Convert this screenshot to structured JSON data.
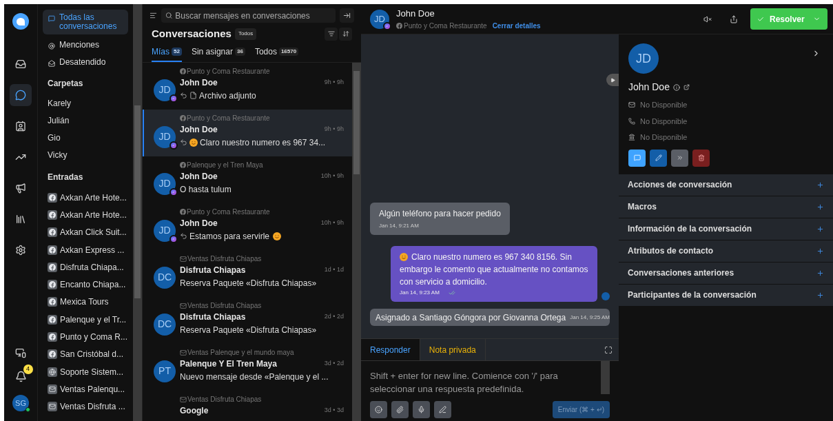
{
  "rail": {
    "items": [
      {
        "kind": "inbox",
        "selected": false
      },
      {
        "kind": "chat",
        "selected": true
      },
      {
        "kind": "contacts",
        "selected": false
      },
      {
        "kind": "reports",
        "selected": false
      },
      {
        "kind": "campaigns",
        "selected": false
      },
      {
        "kind": "library",
        "selected": false
      },
      {
        "kind": "settings",
        "selected": false
      }
    ],
    "bottom": {
      "notifications": "4",
      "avatar": "SG"
    }
  },
  "sidebar": {
    "nav": [
      {
        "label": "Todas las conversaciones",
        "selected": true
      },
      {
        "label": "Menciones",
        "selected": false
      },
      {
        "label": "Desatendido",
        "selected": false
      }
    ],
    "folders_title": "Carpetas",
    "folders": [
      "Karely",
      "Julián",
      "Gio",
      "Vicky"
    ],
    "inboxes_title": "Entradas",
    "inboxes": [
      {
        "name": "Axkan Arte Hote...",
        "kind": "facebook"
      },
      {
        "name": "Axkan Arte Hote...",
        "kind": "facebook"
      },
      {
        "name": "Axkan Click Suit...",
        "kind": "facebook"
      },
      {
        "name": "Axkan Express ...",
        "kind": "facebook"
      },
      {
        "name": "Disfruta Chiapa...",
        "kind": "facebook"
      },
      {
        "name": "Encanto Chiapa...",
        "kind": "facebook"
      },
      {
        "name": "Mexica Tours",
        "kind": "facebook"
      },
      {
        "name": "Palenque y el Tr...",
        "kind": "facebook"
      },
      {
        "name": "Punto y Coma R...",
        "kind": "facebook"
      },
      {
        "name": "San Cristóbal d...",
        "kind": "facebook"
      },
      {
        "name": "Soporte Sistem...",
        "kind": "web"
      },
      {
        "name": "Ventas Palenqu...",
        "kind": "email"
      },
      {
        "name": "Ventas Disfruta ...",
        "kind": "email"
      }
    ]
  },
  "list": {
    "search_placeholder": "Buscar mensajes en conversaciones",
    "title": "Conversaciones",
    "status": "Todos",
    "tabs": [
      {
        "label": "Mías",
        "count": "52",
        "selected": true
      },
      {
        "label": "Sin asignar",
        "count": "36",
        "selected": false
      },
      {
        "label": "Todos",
        "count": "16570",
        "selected": false
      }
    ],
    "conversations": [
      {
        "inbox": "Punto y Coma Restaurante",
        "kind": "facebook",
        "initials": "JD",
        "messenger": true,
        "name": "John Doe",
        "time": "9h • 9h",
        "replied": true,
        "attachment": true,
        "leading_emoji": false,
        "preview": "Archivo adjunto",
        "trailing_emoji": false,
        "selected": false
      },
      {
        "inbox": "Punto y Coma Restaurante",
        "kind": "facebook",
        "initials": "JD",
        "messenger": true,
        "name": "John Doe",
        "time": "9h • 9h",
        "replied": true,
        "attachment": false,
        "leading_emoji": true,
        "preview": "Claro nuestro numero es 967 34...",
        "trailing_emoji": false,
        "selected": true
      },
      {
        "inbox": "Palenque y el Tren Maya",
        "kind": "facebook",
        "initials": "JD",
        "messenger": true,
        "name": "John Doe",
        "time": "10h • 9h",
        "replied": false,
        "attachment": false,
        "leading_emoji": false,
        "preview": "O hasta tulum",
        "trailing_emoji": false,
        "selected": false
      },
      {
        "inbox": "Punto y Coma Restaurante",
        "kind": "facebook",
        "initials": "JD",
        "messenger": true,
        "name": "John Doe",
        "time": "10h • 9h",
        "replied": true,
        "attachment": false,
        "leading_emoji": false,
        "preview": "Estamos para servirle",
        "trailing_emoji": true,
        "selected": false
      },
      {
        "inbox": "Ventas Disfruta Chiapas",
        "kind": "email",
        "initials": "DC",
        "messenger": false,
        "name": "Disfruta Chiapas",
        "time": "1d • 1d",
        "replied": false,
        "attachment": false,
        "leading_emoji": false,
        "preview": "Reserva Paquete «Disfruta Chiapas»",
        "trailing_emoji": false,
        "selected": false
      },
      {
        "inbox": "Ventas Disfruta Chiapas",
        "kind": "email",
        "initials": "DC",
        "messenger": false,
        "name": "Disfruta Chiapas",
        "time": "2d • 2d",
        "replied": false,
        "attachment": false,
        "leading_emoji": false,
        "preview": "Reserva Paquete «Disfruta Chiapas»",
        "trailing_emoji": false,
        "selected": false
      },
      {
        "inbox": "Ventas Palenque y el mundo maya",
        "kind": "email",
        "initials": "PT",
        "messenger": false,
        "name": "Palenque Y El Tren Maya",
        "time": "3d • 2d",
        "replied": false,
        "attachment": false,
        "leading_emoji": false,
        "preview": "Nuevo mensaje desde «Palenque y el ...",
        "trailing_emoji": false,
        "selected": false
      },
      {
        "inbox": "Ventas Disfruta Chiapas",
        "kind": "email",
        "name": "Google",
        "time": "3d • 3d",
        "selected": false
      }
    ]
  },
  "chat": {
    "header": {
      "initials": "JD",
      "name": "John Doe",
      "inbox": "Punto y Coma Restaurante",
      "close_details": "Cerrar detalles",
      "resolve": "Resolver"
    },
    "messages": [
      {
        "kind": "incoming",
        "text": "Algún teléfono para hacer pedido",
        "time": "Jan 14, 9:21 AM"
      },
      {
        "kind": "outgoing",
        "emoji": true,
        "text": "Claro nuestro numero es 967 340 8156. Sin embargo le comento que actualmente no contamos con servicio a domicilio.",
        "time": "Jan 14, 9:23 AM"
      },
      {
        "kind": "activity",
        "text": "Asignado a Santiago Góngora por Giovanna Ortega",
        "time": "Jan 14, 9:25 AM"
      }
    ],
    "composer": {
      "tabs": [
        {
          "label": "Responder",
          "kind": "reply",
          "selected": true
        },
        {
          "label": "Nota privada",
          "kind": "note",
          "selected": false
        }
      ],
      "placeholder": "Shift + enter for new line. Comience con '/' para seleccionar una respuesta predefinida.",
      "send": "Enviar (⌘ + ↵)"
    }
  },
  "contact": {
    "initials": "JD",
    "name": "John Doe",
    "email": "No Disponible",
    "phone": "No Disponible",
    "company": "No Disponible",
    "sections": [
      "Acciones de conversación",
      "Macros",
      "Información de la conversación",
      "Atributos de contacto",
      "Conversaciones anteriores",
      "Participantes de la conversación"
    ]
  }
}
